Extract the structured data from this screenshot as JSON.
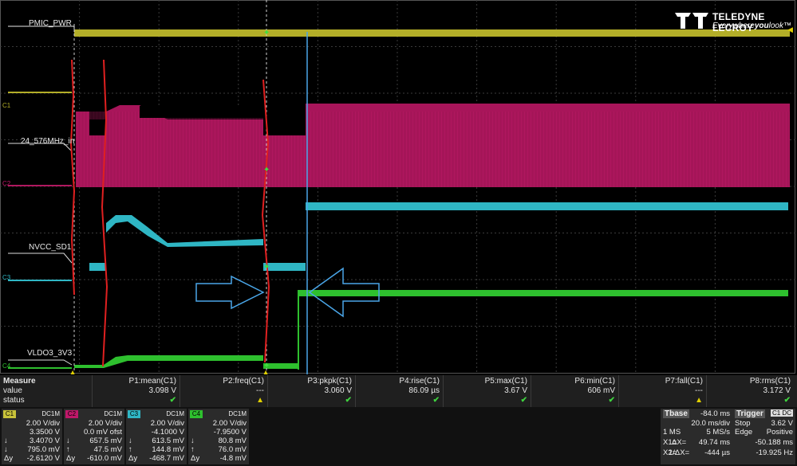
{
  "logo": {
    "name": "TELEDYNE LECROY",
    "tagline_a": "Everywhere",
    "tagline_b": "you",
    "tagline_c": "look",
    "tm": "™"
  },
  "traces": [
    {
      "label": "PMIC_PWR",
      "color": "#b9b52a"
    },
    {
      "label": "24_576MHz_in",
      "color": "#b0185e"
    },
    {
      "label": "NVCC_SD1",
      "color": "#2fb6c4"
    },
    {
      "label": "VLDO3_3V3",
      "color": "#2ec02e"
    }
  ],
  "channel_markers": [
    "C1",
    "C2",
    "C3",
    "C4"
  ],
  "measure": {
    "title": "Measure",
    "row_value": "value",
    "row_status": "status",
    "params": [
      {
        "name": "P1:mean(C1)",
        "value": "3.098 V",
        "status": "ok"
      },
      {
        "name": "P2:freq(C1)",
        "value": "---",
        "status": "warn"
      },
      {
        "name": "P3:pkpk(C1)",
        "value": "3.060 V",
        "status": "ok"
      },
      {
        "name": "P4:rise(C1)",
        "value": "86.09 µs",
        "status": "ok"
      },
      {
        "name": "P5:max(C1)",
        "value": "3.67 V",
        "status": "ok"
      },
      {
        "name": "P6:min(C1)",
        "value": "606 mV",
        "status": "ok"
      },
      {
        "name": "P7:fall(C1)",
        "value": "---",
        "status": "warn"
      },
      {
        "name": "P8:rms(C1)",
        "value": "3.172 V",
        "status": "ok"
      }
    ]
  },
  "channels": [
    {
      "id": "C1",
      "coupling": "DC1M",
      "color": "#c8c23a",
      "vdiv": "2.00 V/div",
      "offset": "3.3500 V",
      "r3": "3.4070 V",
      "r4": "795.0 mV",
      "r5": "-2.6120 V",
      "s3": "↓",
      "s4": "↓",
      "s5": "Δy"
    },
    {
      "id": "C2",
      "coupling": "DC1M",
      "color": "#c0186a",
      "vdiv": "2.00 V/div",
      "offset": "0.0 mV ofst",
      "r3": "657.5 mV",
      "r4": "47.5 mV",
      "r5": "-610.0 mV",
      "s3": "↓",
      "s4": "↑",
      "s5": "Δy"
    },
    {
      "id": "C3",
      "coupling": "DC1M",
      "color": "#2fb6c4",
      "vdiv": "2.00 V/div",
      "offset": "-4.1000 V",
      "r3": "613.5 mV",
      "r4": "144.8 mV",
      "r5": "-468.7 mV",
      "s3": "↓",
      "s4": "↑",
      "s5": "Δy"
    },
    {
      "id": "C4",
      "coupling": "DC1M",
      "color": "#2ec02e",
      "vdiv": "2.00 V/div",
      "offset": "-7.9500 V",
      "r3": "80.8 mV",
      "r4": "76.0 mV",
      "r5": "-4.8 mV",
      "s3": "↓",
      "s4": "↑",
      "s5": "Δy"
    }
  ],
  "timebase": {
    "title": "Tbase",
    "delay": "-84.0 ms",
    "tdiv": "20.0 ms/div",
    "samples": "1 MS",
    "rate": "5 MS/s",
    "x1_label": "X1=",
    "x1": "49.74 ms",
    "dx_label": "ΔX=",
    "dx": "-50.188 ms",
    "x2_label": "X2=",
    "x2": "-444 µs",
    "inv_label": "1/ΔX=",
    "inv": "-19.925 Hz"
  },
  "trigger": {
    "title": "Trigger",
    "source": "C1 DC",
    "mode": "Stop",
    "level": "3.62 V",
    "type": "Edge",
    "slope": "Positive"
  }
}
